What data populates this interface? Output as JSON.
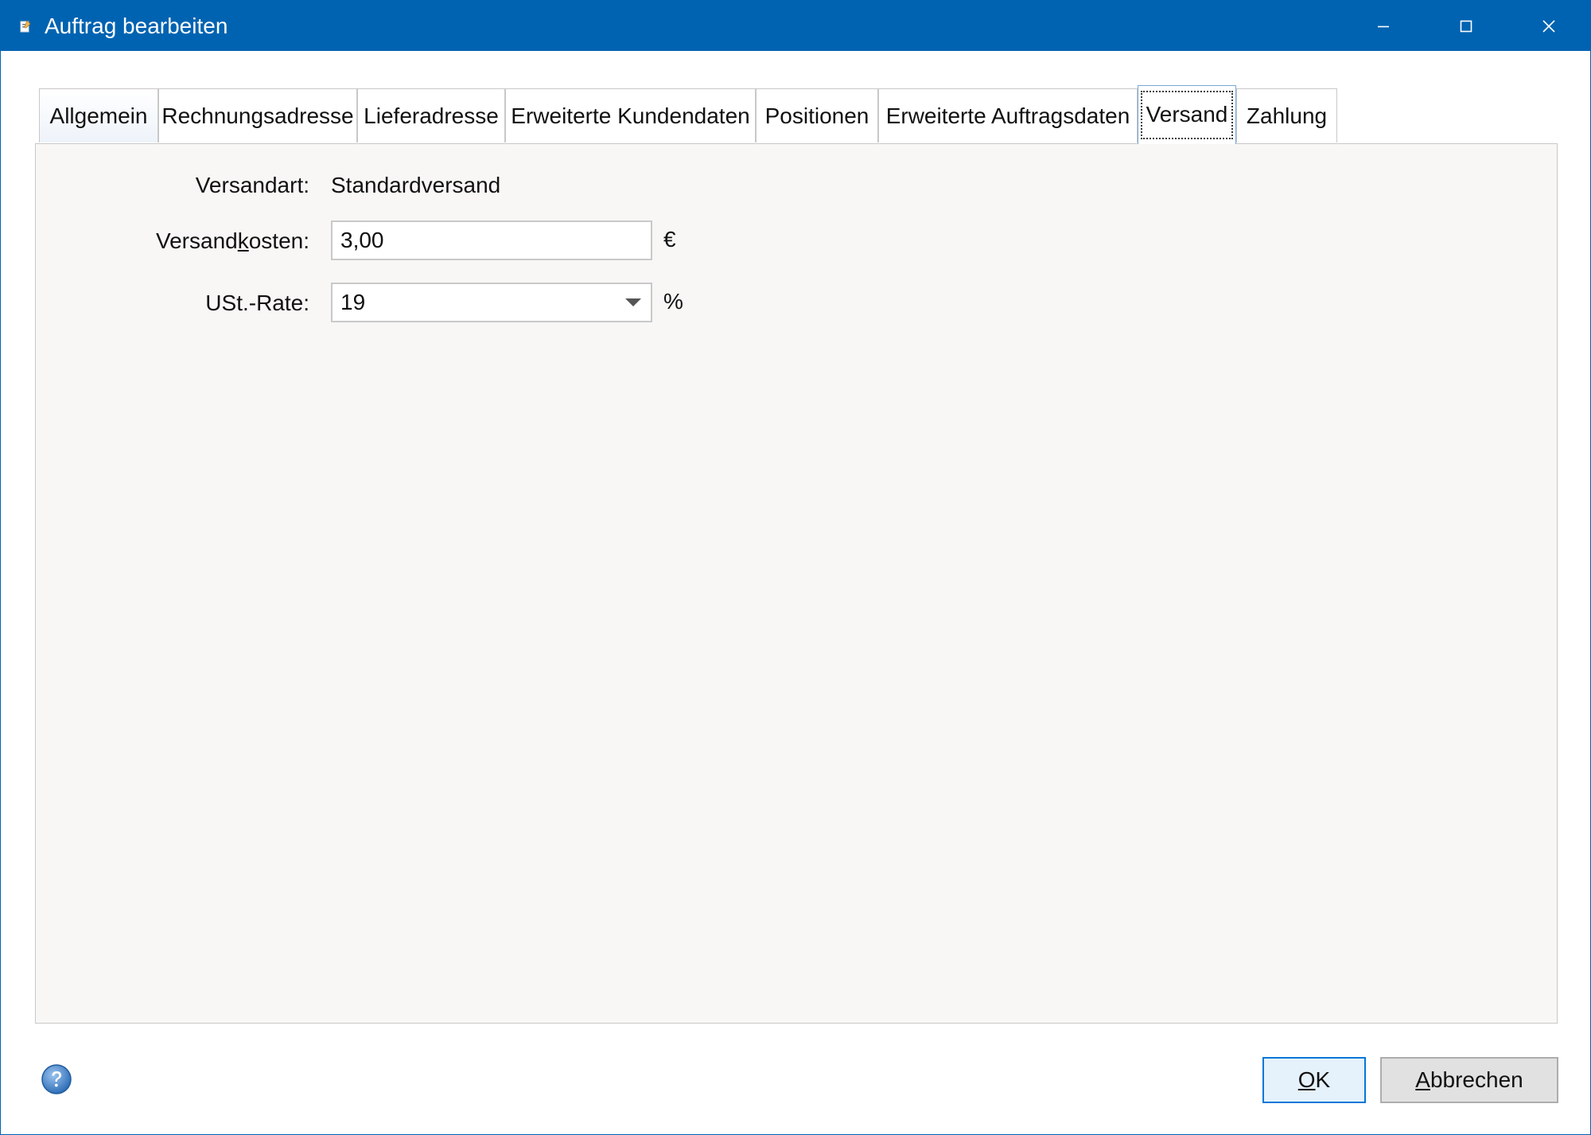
{
  "window": {
    "title": "Auftrag bearbeiten"
  },
  "tabs": [
    {
      "label": "Allgemein"
    },
    {
      "label": "Rechnungsadresse"
    },
    {
      "label": "Lieferadresse"
    },
    {
      "label": "Erweiterte Kundendaten"
    },
    {
      "label": "Positionen"
    },
    {
      "label": "Erweiterte Auftragsdaten"
    },
    {
      "label": "Versand",
      "active": true
    },
    {
      "label": "Zahlung"
    }
  ],
  "shipping": {
    "method_label": "Versandart:",
    "method_value": "Standardversand",
    "cost_label_pre": "Versand",
    "cost_label_mnemonic": "k",
    "cost_label_post": "osten:",
    "cost_value": "3,00",
    "cost_unit": "€",
    "vat_label": "USt.-Rate:",
    "vat_value": "19",
    "vat_unit": "%"
  },
  "buttons": {
    "ok_mnemonic": "O",
    "ok_rest": "K",
    "cancel_mnemonic": "A",
    "cancel_rest": "bbrechen"
  },
  "colors": {
    "titlebar": "#0063b1",
    "ok_border": "#0078d7"
  }
}
